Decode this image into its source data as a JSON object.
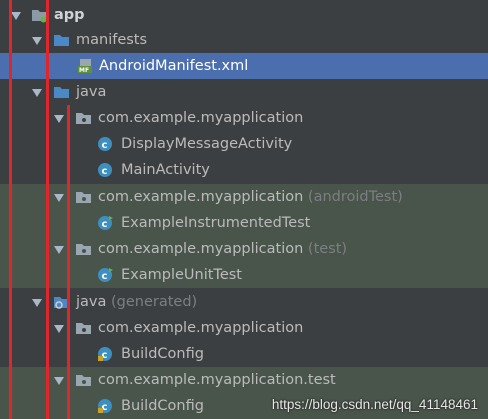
{
  "tree": {
    "app": "app",
    "manifests": "manifests",
    "android_manifest": "AndroidManifest.xml",
    "java": "java",
    "pkg_main": "com.example.myapplication",
    "display_message_activity": "DisplayMessageActivity",
    "main_activity": "MainActivity",
    "pkg_android_test": "com.example.myapplication",
    "android_test_suffix": "(androidTest)",
    "example_instrumented_test": "ExampleInstrumentedTest",
    "pkg_test": "com.example.myapplication",
    "test_suffix": "(test)",
    "example_unit_test": "ExampleUnitTest",
    "java_generated": "java",
    "generated_suffix": "(generated)",
    "pkg_generated": "com.example.myapplication",
    "build_config_1": "BuildConfig",
    "pkg_generated_test": "com.example.myapplication.test",
    "build_config_2": "BuildConfig"
  },
  "watermark": "https://blog.csdn.net/qq_41148461",
  "colors": {
    "background": "#3c3f41",
    "selection": "#4b6eaf",
    "test_highlight": "#49544a",
    "folder_blue": "#4a88c7",
    "class_icon": "#3d8fbf",
    "annotation_red": "#e0262a"
  }
}
